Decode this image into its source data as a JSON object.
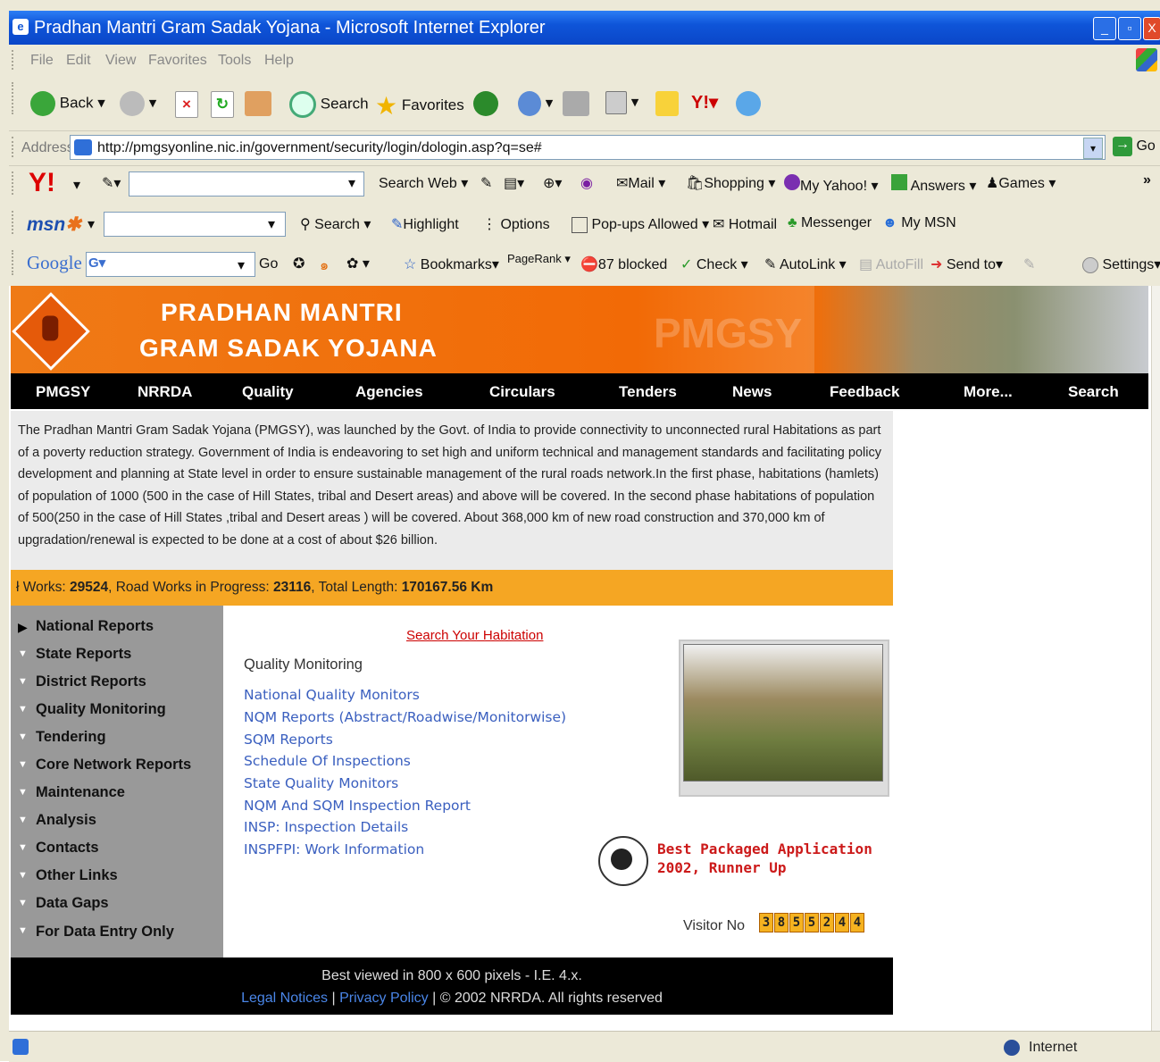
{
  "window": {
    "title": "Pradhan Mantri Gram Sadak Yojana - Microsoft Internet Explorer",
    "minimize": "_",
    "maximize": "▫",
    "close": "X"
  },
  "menu": [
    "File",
    "Edit",
    "View",
    "Favorites",
    "Tools",
    "Help"
  ],
  "toolbar": {
    "back": "Back",
    "search": "Search",
    "favorites": "Favorites"
  },
  "address": {
    "label": "Address",
    "url": "http://pmgsyonline.nic.in/government/security/login/dologin.asp?q=se#",
    "go": "Go"
  },
  "yahoo_bar": {
    "search_web": "Search Web",
    "mail": "Mail",
    "shopping": "Shopping",
    "my_yahoo": "My Yahoo!",
    "answers": "Answers",
    "games": "Games",
    "more": "»"
  },
  "msn_bar": {
    "logo": "msn",
    "search": "Search",
    "highlight": "Highlight",
    "options": "Options",
    "popups": "Pop-ups Allowed",
    "hotmail": "Hotmail",
    "messenger": "Messenger",
    "my_msn": "My MSN"
  },
  "google_bar": {
    "logo": "Google",
    "go": "Go",
    "bookmarks": "Bookmarks",
    "pagerank": "PageRank",
    "blocked": "87 blocked",
    "check": "Check",
    "autolink": "AutoLink",
    "autofill": "AutoFill",
    "send_to": "Send to",
    "settings": "Settings"
  },
  "banner": {
    "line1": "PRADHAN MANTRI",
    "line2": "GRAM SADAK YOJANA",
    "watermark": "PMGSY"
  },
  "nav": [
    "PMGSY",
    "NRRDA",
    "Quality",
    "Agencies",
    "Circulars",
    "Tenders",
    "News",
    "Feedback",
    "More...",
    "Search"
  ],
  "intro": "The Pradhan Mantri Gram Sadak Yojana (PMGSY), was launched by the Govt. of India to provide connectivity to unconnected rural Habitations as part of a poverty reduction strategy. Government of India is endeavoring to set high and uniform technical and management standards and facilitating policy development and planning at State level in order to ensure sustainable management of the rural roads network.In the first phase, habitations (hamlets) of population of 1000 (500 in the case of Hill States, tribal and Desert areas) and above will be covered. In the second phase habitations of population of 500(250 in the case of Hill States ,tribal and Desert areas ) will be covered. About 368,000 km of new road construction and 370,000 km of upgradation/renewal is expected to be done at a cost of about $26 billion.",
  "ticker": {
    "works_label": "ł Works: ",
    "works_value": "29524",
    "progress_label": ", Road Works in Progress: ",
    "progress_value": "23116",
    "length_label": ", Total Length: ",
    "length_value": "170167.56 Km"
  },
  "sidebar": [
    "National Reports",
    "State Reports",
    "District Reports",
    "Quality Monitoring",
    "Tendering",
    "Core Network Reports",
    "Maintenance",
    "Analysis",
    "Contacts",
    "Other Links",
    "Data Gaps",
    "For Data Entry Only"
  ],
  "main": {
    "habitation_link": "Search Your Habitation",
    "section_title": "Quality Monitoring",
    "links": [
      "National Quality Monitors",
      "NQM Reports (Abstract/Roadwise/Monitorwise)",
      "SQM Reports",
      "Schedule Of Inspections",
      "State Quality Monitors",
      "NQM And SQM Inspection Report",
      "INSP: Inspection Details",
      "INSPFPI: Work Information"
    ],
    "award_line1": "Best Packaged Application",
    "award_line2": "2002, Runner Up",
    "visitor_label": "Visitor No",
    "visitor_digits": [
      "3",
      "8",
      "5",
      "5",
      "2",
      "4",
      "4"
    ]
  },
  "footer": {
    "line1": "Best viewed in 800 x 600 pixels - I.E. 4.x.",
    "legal": "Legal Notices",
    "sep1": " | ",
    "privacy": "Privacy Policy",
    "rights": " | © 2002 NRRDA. All rights reserved"
  },
  "status": {
    "zone": "Internet"
  }
}
